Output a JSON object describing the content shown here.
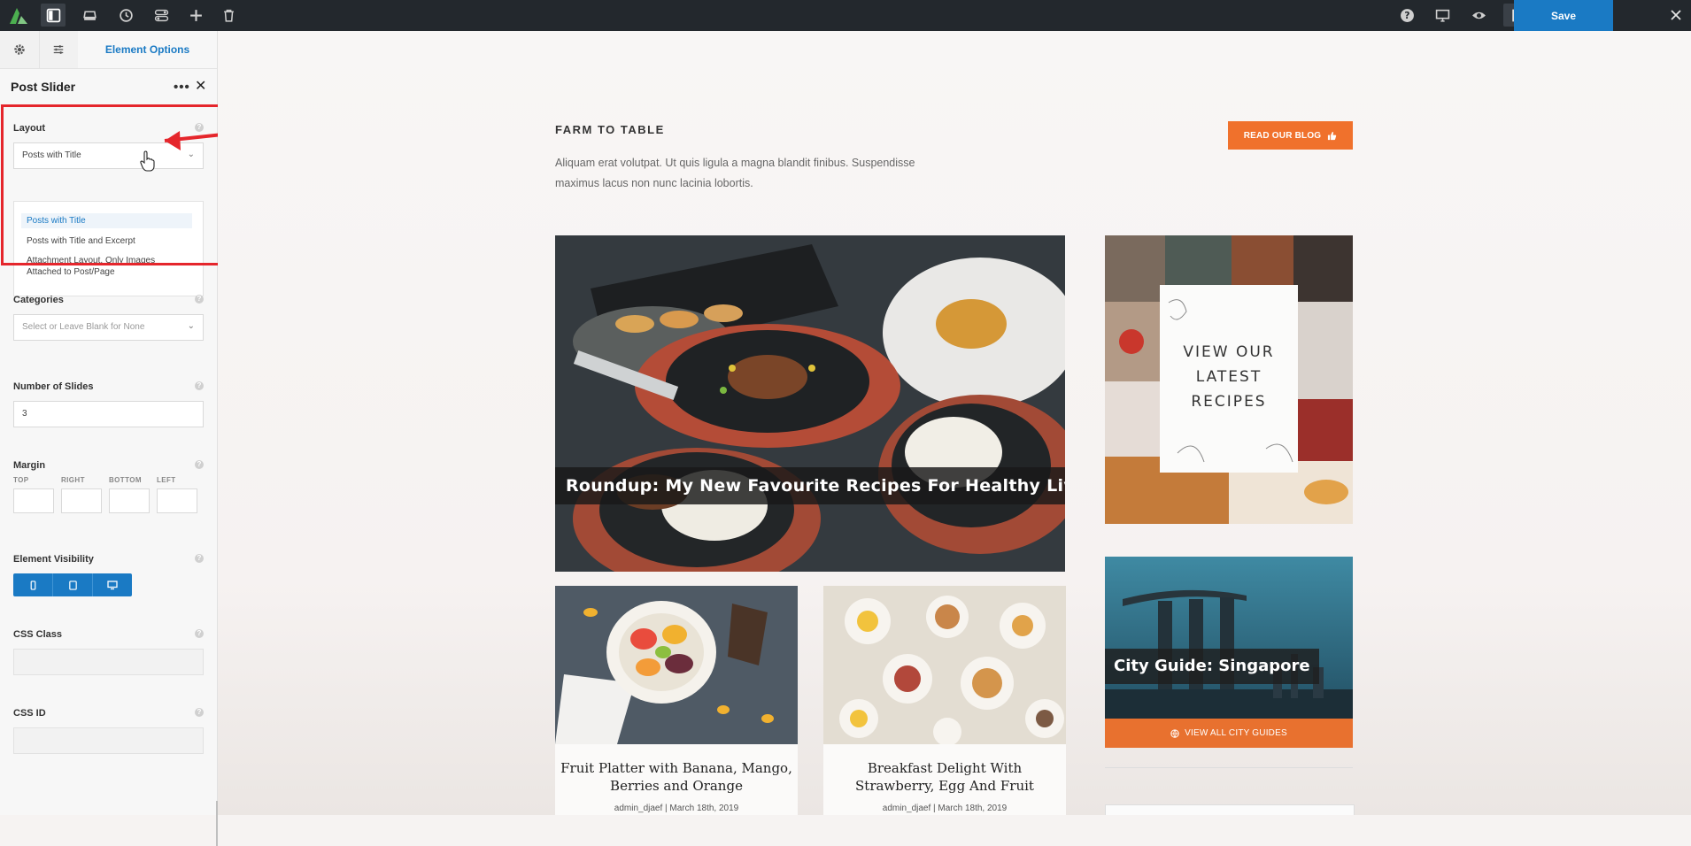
{
  "toolbar": {
    "save_label": "Save",
    "icons": [
      "logo-icon",
      "layout-icon",
      "library-icon",
      "history-icon",
      "settings-toggle-icon",
      "plus-icon",
      "trash-icon",
      "help-icon",
      "desktop-icon",
      "eye-icon",
      "document-icon",
      "page-icon",
      "close-icon"
    ],
    "accent": "#1a7ac4"
  },
  "sidebar": {
    "tab_label": "Element Options",
    "title": "Post Slider",
    "layout": {
      "label": "Layout",
      "value": "Posts with Title",
      "options": [
        "Posts with Title",
        "Posts with Title and Excerpt",
        "Attachment Layout, Only Images",
        "Attached to Post/Page"
      ]
    },
    "categories": {
      "label": "Categories",
      "placeholder": "Select or Leave Blank for None"
    },
    "slides": {
      "label": "Number of Slides",
      "value": "3"
    },
    "margin": {
      "label": "Margin",
      "top": "TOP",
      "right": "RIGHT",
      "bottom": "BOTTOM",
      "left": "LEFT"
    },
    "visibility": {
      "label": "Element Visibility"
    },
    "css_class": {
      "label": "CSS Class"
    },
    "css_id": {
      "label": "CSS ID"
    }
  },
  "content": {
    "eyebrow": "FARM TO TABLE",
    "intro": "Aliquam erat volutpat. Ut quis ligula a magna blandit finibus. Suspendisse maximus lacus non nunc lacinia lobortis.",
    "cta_label": "READ OUR BLOG",
    "feature_title": "Roundup: My New Favourite Recipes For Healthy Living",
    "card1": {
      "title_1": "Fruit Platter with Banana, Mango,",
      "title_2": "Berries and Orange",
      "meta": "admin_djaef | March 18th, 2019"
    },
    "card2": {
      "title_1": "Breakfast Delight With",
      "title_2": "Strawberry, Egg And Fruit",
      "meta": "admin_djaef | March 18th, 2019"
    },
    "recipes": {
      "line1": "VIEW OUR",
      "line2": "LATEST",
      "line3": "RECIPES"
    },
    "city": {
      "title": "City Guide: Singapore",
      "link": "VIEW ALL CITY GUIDES"
    },
    "accent_orange": "#f0712c"
  }
}
